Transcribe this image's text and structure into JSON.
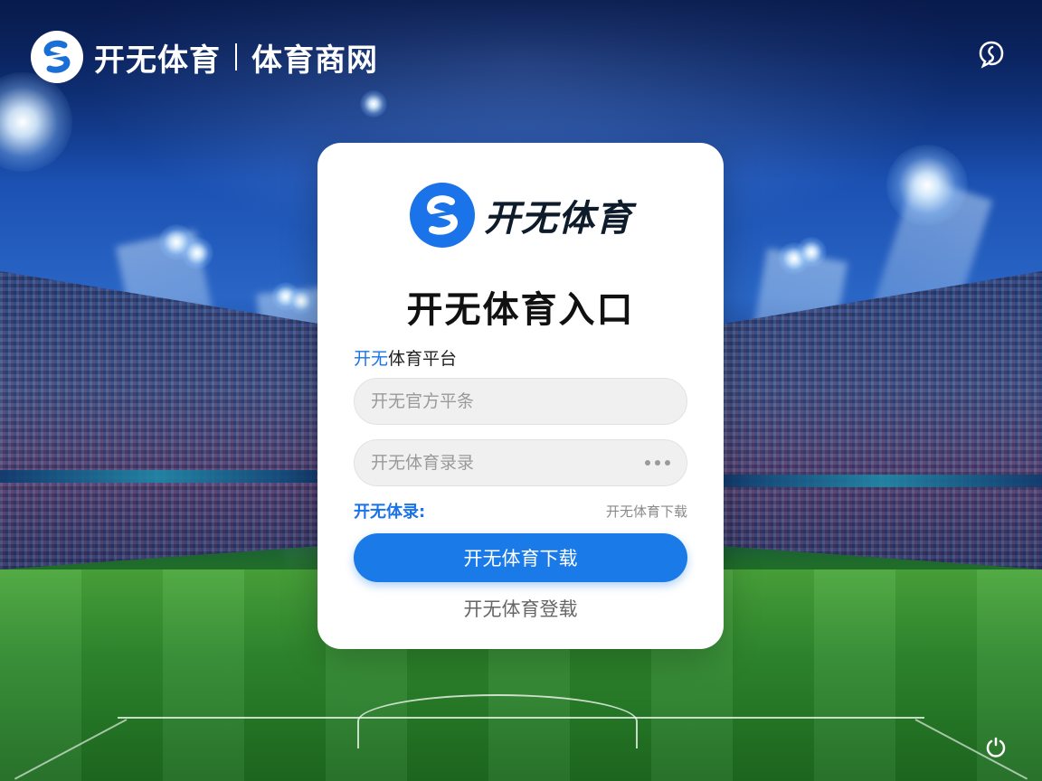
{
  "header": {
    "brand_name": "开无体育",
    "brand_sub": "体育商网"
  },
  "card": {
    "logo_name": "开无体育",
    "title": "开无体育入口",
    "platform_label_highlight": "开无",
    "platform_label_rest": "体育平台",
    "username": {
      "placeholder": "开无官方平条",
      "value": ""
    },
    "password": {
      "placeholder": "开无体育录录",
      "value": ""
    },
    "meta_left": "开无体录:",
    "meta_right": "开无体育下载",
    "primary_button": "开无体育下载",
    "secondary_link": "开无体育登载"
  },
  "colors": {
    "accent": "#1a7ae8",
    "card_bg": "#ffffff",
    "field_bg": "#f0f0f0"
  },
  "icons": {
    "top_right": "chat-bubble-icon",
    "bottom_right": "power-icon",
    "brand": "s-logo-icon"
  }
}
